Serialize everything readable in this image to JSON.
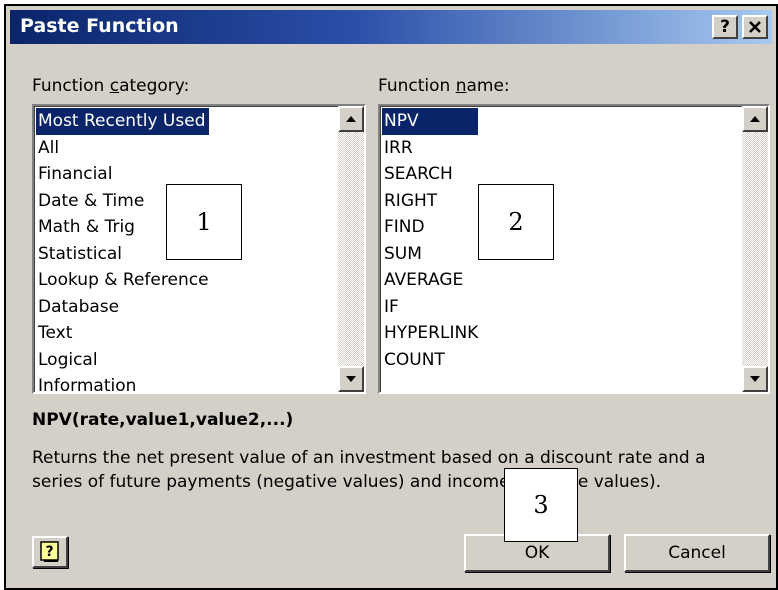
{
  "window": {
    "title": "Paste Function",
    "help_label": "?",
    "close_label": "✕"
  },
  "category": {
    "label_prefix": "Function ",
    "label_underlined": "c",
    "label_suffix": "ategory:",
    "items": [
      {
        "label": "Most Recently Used",
        "selected": true
      },
      {
        "label": "All"
      },
      {
        "label": "Financial"
      },
      {
        "label": "Date & Time"
      },
      {
        "label": "Math & Trig"
      },
      {
        "label": "Statistical"
      },
      {
        "label": "Lookup & Reference"
      },
      {
        "label": "Database"
      },
      {
        "label": "Text"
      },
      {
        "label": "Logical"
      },
      {
        "label": "Information"
      }
    ]
  },
  "function": {
    "label_prefix": "Function ",
    "label_underlined": "n",
    "label_suffix": "ame:",
    "items": [
      {
        "label": "NPV",
        "selected": true
      },
      {
        "label": "IRR"
      },
      {
        "label": "SEARCH"
      },
      {
        "label": "RIGHT"
      },
      {
        "label": "FIND"
      },
      {
        "label": "SUM"
      },
      {
        "label": "AVERAGE"
      },
      {
        "label": "IF"
      },
      {
        "label": "HYPERLINK"
      },
      {
        "label": "COUNT"
      }
    ]
  },
  "syntax": "NPV(rate,value1,value2,...)",
  "description": "Returns the net present value of an investment based on a discount rate and a series of future payments (negative values) and income (positive values).",
  "buttons": {
    "ok": "OK",
    "cancel": "Cancel"
  },
  "annotations": {
    "a1": "1",
    "a2": "2",
    "a3": "3"
  },
  "icons": {
    "help": "help-icon",
    "scroll_up": "arrow-up-icon",
    "scroll_down": "arrow-down-icon"
  }
}
